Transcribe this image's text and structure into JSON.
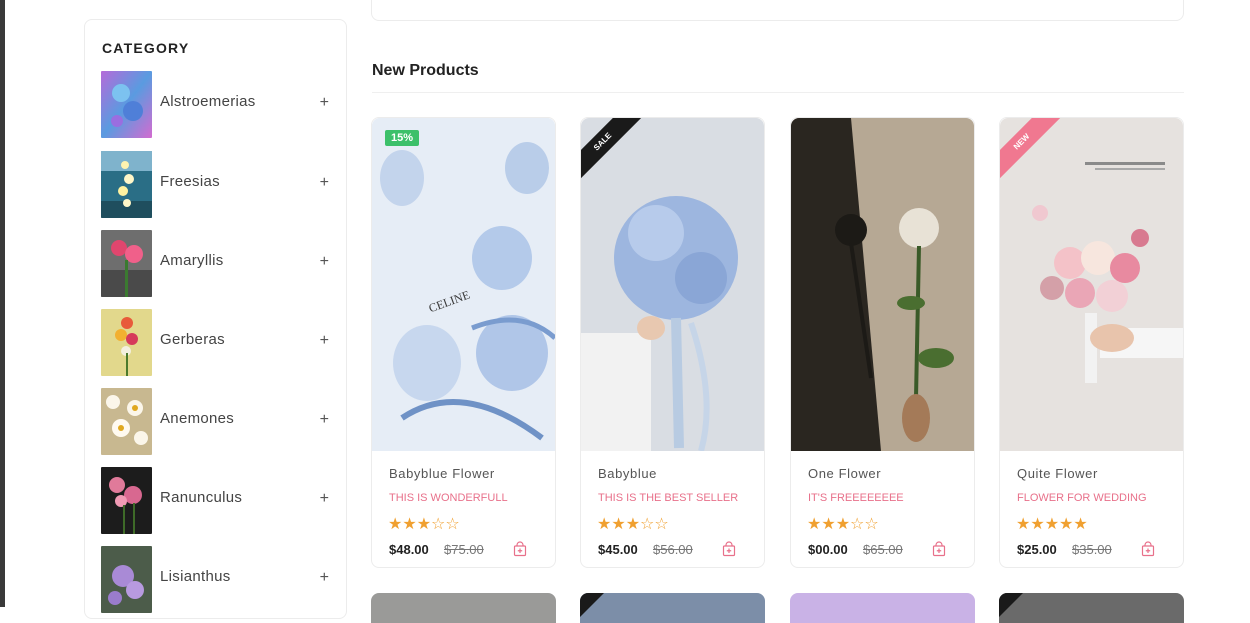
{
  "sidebar": {
    "title": "CATEGORY",
    "items": [
      {
        "label": "Alstroemerias"
      },
      {
        "label": "Freesias"
      },
      {
        "label": "Amaryllis"
      },
      {
        "label": "Gerberas"
      },
      {
        "label": "Anemones"
      },
      {
        "label": "Ranunculus"
      },
      {
        "label": "Lisianthus"
      }
    ],
    "expand_symbol": "+"
  },
  "main": {
    "section_title": "New Products",
    "products": [
      {
        "name": "Babyblue Flower",
        "subtitle": "THIS IS WONDERFULL",
        "rating": 3,
        "stars": "★★★☆☆",
        "price": "$48.00",
        "old_price": "$75.00",
        "badge": "15%",
        "image_caption": "CELINE"
      },
      {
        "name": "Babyblue",
        "subtitle": "THIS IS THE BEST SELLER",
        "rating": 3,
        "stars": "★★★☆☆",
        "price": "$45.00",
        "old_price": "$56.00",
        "badge": "SALE"
      },
      {
        "name": "One Flower",
        "subtitle": "IT'S FREEEEEEEE",
        "rating": 3,
        "stars": "★★★☆☆",
        "price": "$00.00",
        "old_price": "$65.00",
        "badge": ""
      },
      {
        "name": "Quite Flower",
        "subtitle": "FLOWER FOR WEDDING",
        "rating": 5,
        "stars": "★★★★★",
        "price": "$25.00",
        "old_price": "$35.00",
        "badge": "NEW"
      }
    ]
  },
  "colors": {
    "accent_pink": "#e8708a",
    "star": "#f0a030",
    "badge_green": "#3cc06a",
    "ribbon_sale": "#1a1a1a",
    "ribbon_new": "#f07890"
  },
  "icons": [
    "plus-icon",
    "cart-icon",
    "star-icon"
  ]
}
